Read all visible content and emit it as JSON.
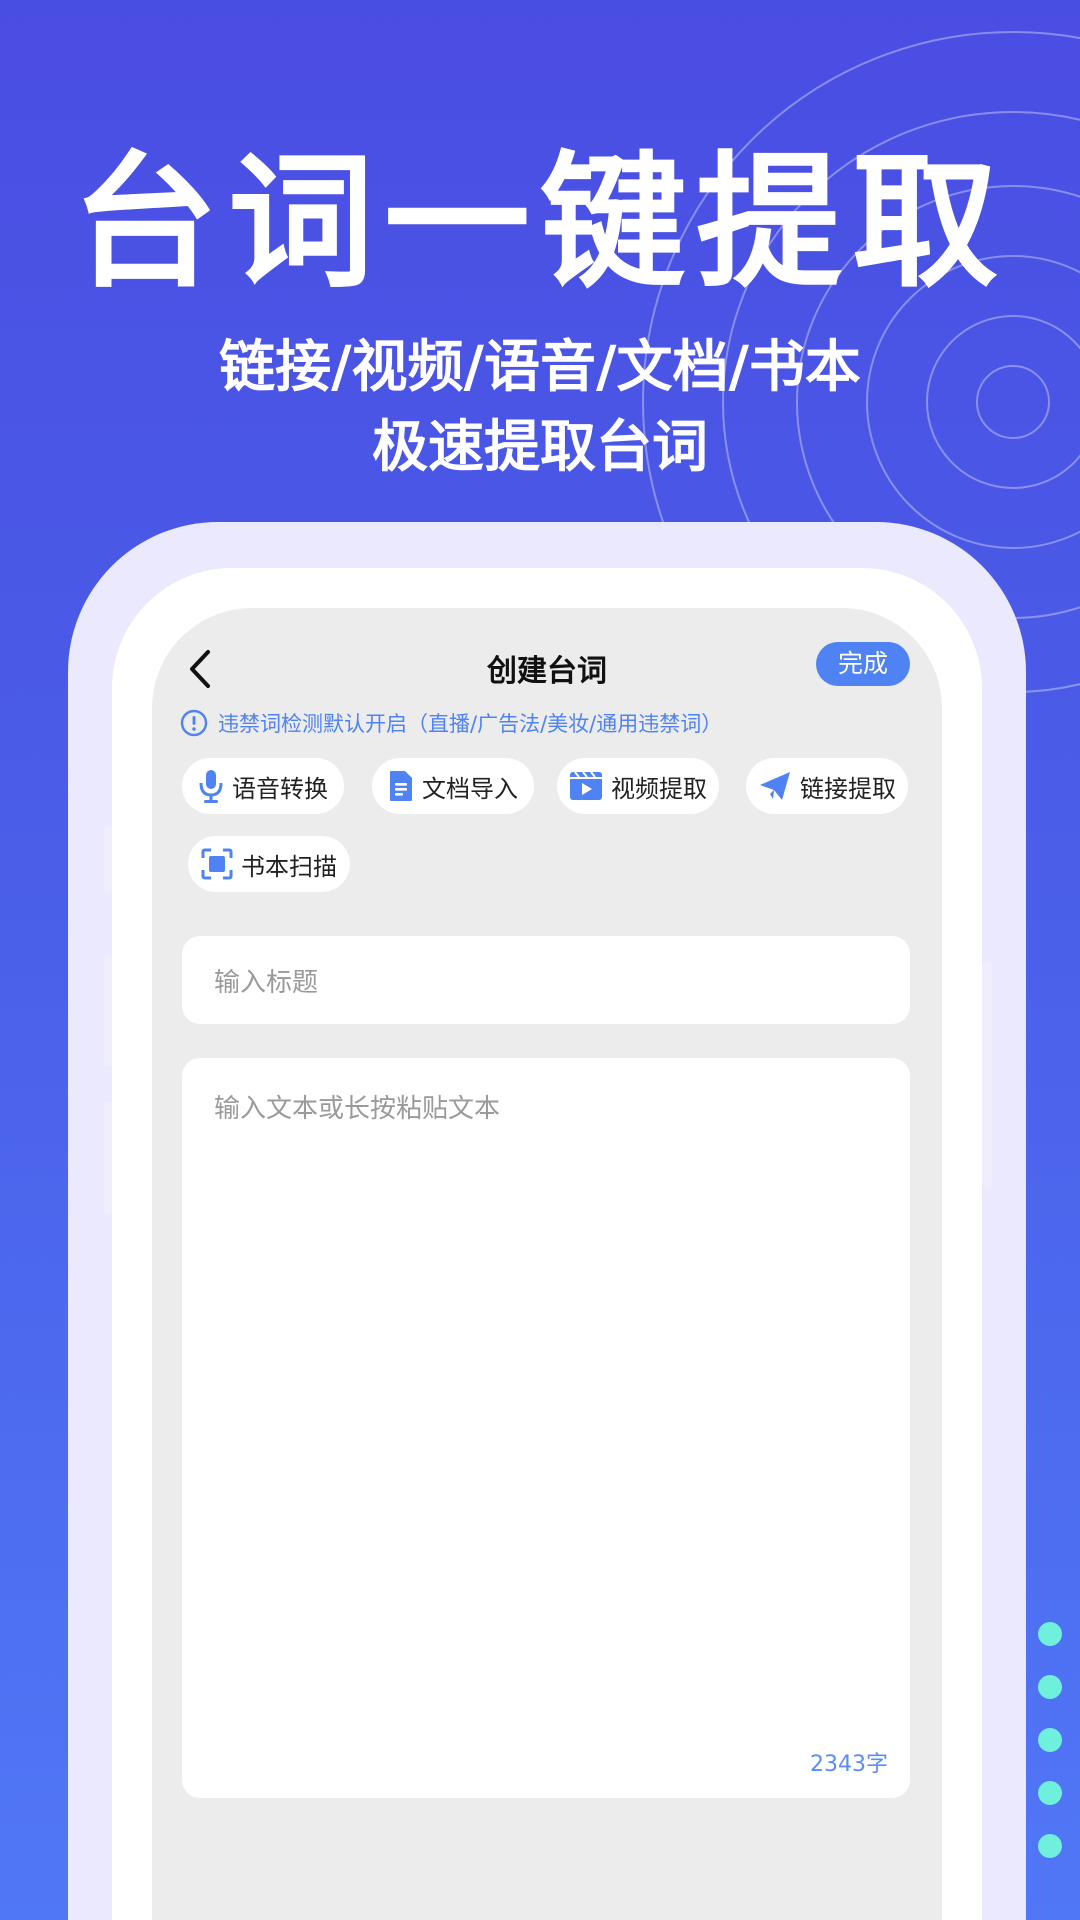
{
  "promo": {
    "headline": "台词一键提取",
    "subline_1": "链接/视频/语音/文档/书本",
    "subline_2": "极速提取台词"
  },
  "app": {
    "title": "创建台词",
    "done_label": "完成",
    "notice": "违禁词检测默认开启（直播/广告法/美妆/通用违禁词）",
    "tools": [
      {
        "label": "语音转换",
        "icon": "microphone-icon"
      },
      {
        "label": "文档导入",
        "icon": "document-icon"
      },
      {
        "label": "视频提取",
        "icon": "video-icon"
      },
      {
        "label": "链接提取",
        "icon": "paper-plane-icon"
      },
      {
        "label": "书本扫描",
        "icon": "scan-icon"
      }
    ],
    "title_placeholder": "输入标题",
    "body_placeholder": "输入文本或长按粘贴文本",
    "char_count": "2343字"
  },
  "colors": {
    "background_top": "#4a4de3",
    "background_bottom": "#5077f6",
    "accent": "#4f83f3",
    "dots": "#6ff0dc"
  }
}
